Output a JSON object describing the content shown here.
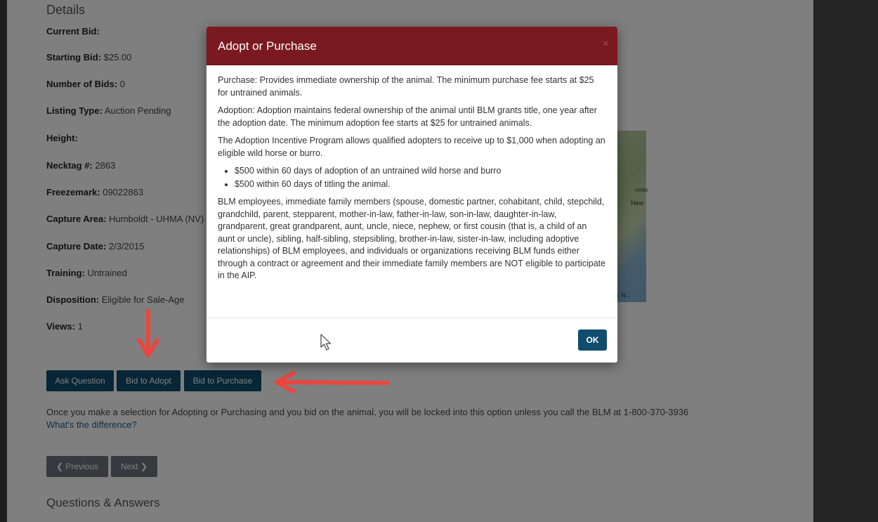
{
  "details": {
    "heading": "Details",
    "items": [
      {
        "label": "Current Bid:",
        "value": ""
      },
      {
        "label": "Starting Bid:",
        "value": " $25.00"
      },
      {
        "label": "Number of Bids:",
        "value": " 0"
      },
      {
        "label": "Listing Type:",
        "value": " Auction Pending"
      },
      {
        "label": "Height:",
        "value": ""
      },
      {
        "label": "Necktag #:",
        "value": " 2863"
      },
      {
        "label": "Freezemark:",
        "value": " 09022863"
      },
      {
        "label": "Capture Area:",
        "value": " Humboldt - UHMA (NV)"
      },
      {
        "label": "Capture Date:",
        "value": " 2/3/2015"
      },
      {
        "label": "Training:",
        "value": " Untrained"
      },
      {
        "label": "Disposition:",
        "value": "  Eligible for Sale-Age"
      },
      {
        "label": "Views:",
        "value": " 1"
      }
    ]
  },
  "map": {
    "labels": [
      "ronto",
      "New",
      "n, N..."
    ]
  },
  "actions": {
    "ask_question": "Ask Question",
    "bid_to_adopt": "Bid to Adopt",
    "bid_to_purchase": "Bid to Purchase"
  },
  "notice": {
    "text": "Once you make a selection for Adopting or Purchasing and you bid on the animal, you will be locked into this option unless you call the BLM at 1-800-370-3936",
    "link": "What's the difference?"
  },
  "pagination": {
    "previous": "Previous",
    "next": "Next"
  },
  "qa": {
    "heading": "Questions & Answers"
  },
  "modal": {
    "title": "Adopt or Purchase",
    "close": "×",
    "paragraphs": [
      "Purchase: Provides immediate ownership of the animal. The minimum purchase fee starts at $25 for untrained animals.",
      "Adoption: Adoption maintains federal ownership of the animal until BLM grants title, one year after the adoption date. The minimum adoption fee starts at $25 for untrained animals.",
      "The Adoption Incentive Program allows qualified adopters to receive up to $1,000 when adopting an eligible wild horse or burro."
    ],
    "bullets": [
      "$500 within 60 days of adoption of an untrained wild horse and burro",
      "$500 within 60 days of titling the animal."
    ],
    "eligibility": "BLM employees, immediate family members (spouse, domestic partner, cohabitant, child, stepchild, grandchild, parent, stepparent, mother-in-law, father-in-law, son-in-law, daughter-in-law, grandparent, great grandparent, aunt, uncle, niece, nephew, or first cousin (that is, a child of an aunt or uncle), sibling, half-sibling, stepsibling, brother-in-law, sister-in-law, including adoptive relationships) of BLM employees, and individuals or organizations receiving BLM funds either through a contract or agreement and their immediate family members are NOT eligible to participate in the AIP.",
    "ok_label": "OK"
  },
  "colors": {
    "modal_header": "#7a1a20",
    "primary_button": "#0f4c6e",
    "arrow": "#e8473f",
    "link": "#1d5f96"
  }
}
